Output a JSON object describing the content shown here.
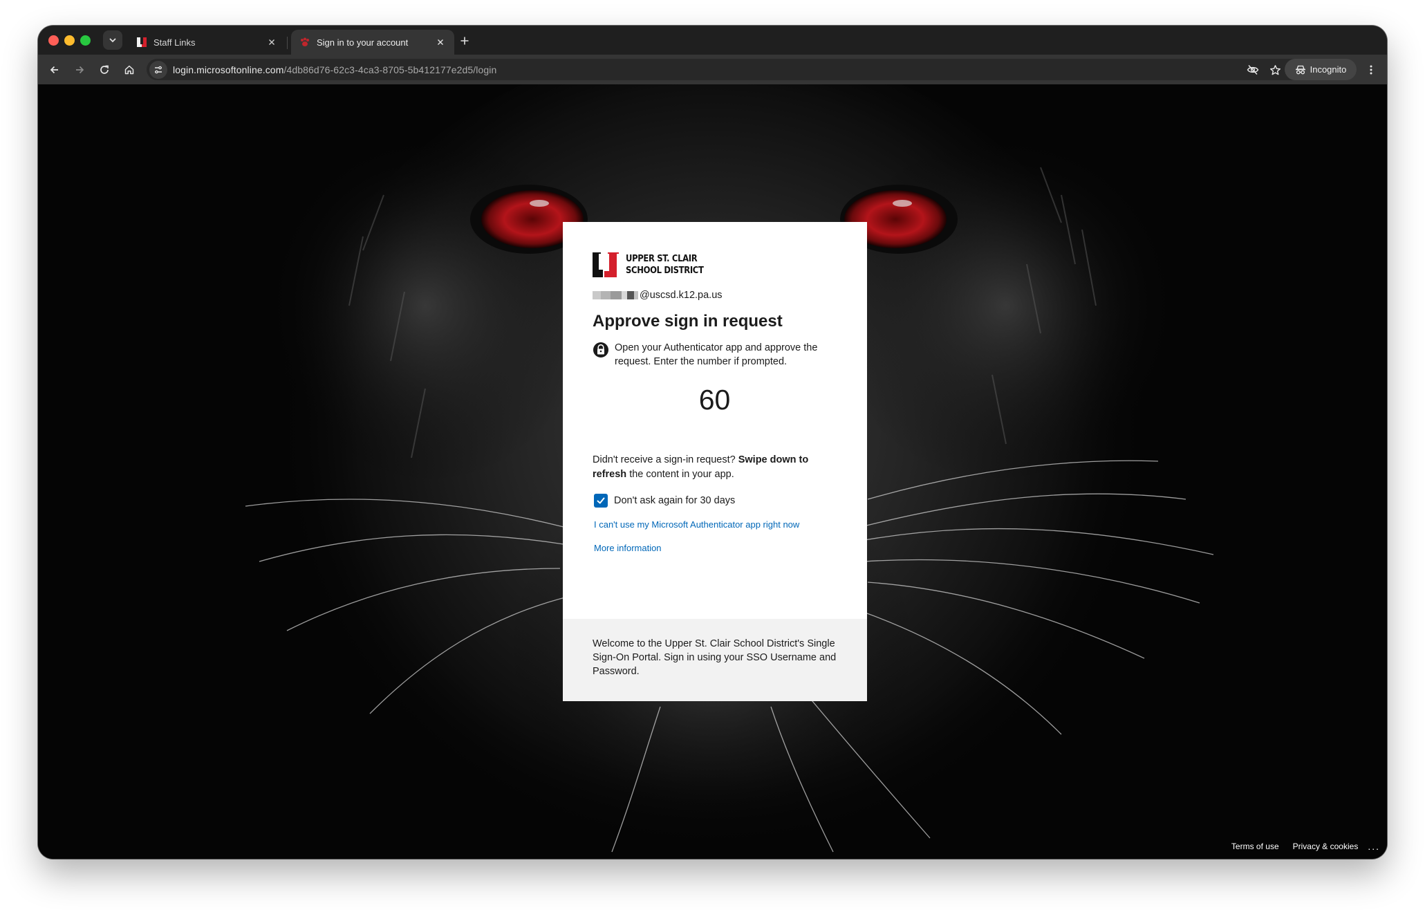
{
  "browser": {
    "tabs": [
      {
        "title": "Staff Links",
        "favicon": "uscsd-logo-icon",
        "active": false
      },
      {
        "title": "Sign in to your account",
        "favicon": "paw-icon",
        "active": true
      }
    ],
    "url_host": "login.microsoftonline.com",
    "url_path": "/4db86d76-62c3-4ca3-8705-5b412177e2d5/login",
    "incognito_label": "Incognito"
  },
  "logo": {
    "line1": "UPPER ST. CLAIR",
    "line2": "SCHOOL DISTRICT",
    "colors": {
      "black": "#111111",
      "red": "#d4202c"
    }
  },
  "signin": {
    "account_domain": "@uscsd.k12.pa.us",
    "heading": "Approve sign in request",
    "instruction": "Open your Authenticator app and approve the request. Enter the number if prompted.",
    "number": "60",
    "hint_prefix": "Didn't receive a sign-in request? ",
    "hint_bold": "Swipe down to refresh",
    "hint_suffix": " the content in your app.",
    "remember_label": "Don't ask again for 30 days",
    "remember_checked": true,
    "cant_use_link": "I can't use my Microsoft Authenticator app right now",
    "more_info_link": "More information",
    "footer_text": "Welcome to the Upper St. Clair School District's Single Sign-On Portal. Sign in using your SSO Username and Password."
  },
  "page_footer": {
    "terms": "Terms of use",
    "privacy": "Privacy & cookies",
    "more": "..."
  },
  "colors": {
    "link": "#0067b8",
    "checkbox": "#0067b8",
    "eyes": "#b3141a"
  }
}
